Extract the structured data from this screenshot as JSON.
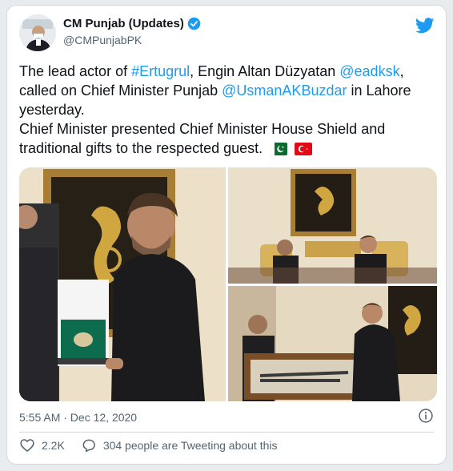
{
  "author": {
    "display_name": "CM Punjab (Updates)",
    "handle": "@CMPunjabPK",
    "verified": true
  },
  "tweet": {
    "text_part1": "The lead actor of ",
    "hashtag": "#Ertugrul",
    "text_part2": ", Engin Altan Düzyatan ",
    "mention1": "@eadksk",
    "text_part3": ", called on Chief Minister Punjab ",
    "mention2": "@UsmanAKBuzdar",
    "text_part4": " in Lahore yesterday.",
    "text_line2": "Chief Minister presented Chief Minister House Shield and traditional gifts to the respected guest. "
  },
  "meta": {
    "timestamp": "5:55 AM · Dec 12, 2020"
  },
  "actions": {
    "likes": "2.2K",
    "tweeting": "304 people are Tweeting about this"
  },
  "colors": {
    "accent": "#1d9bf0",
    "text": "#0f1419",
    "muted": "#536471",
    "border": "#cfd9de"
  },
  "icons": [
    "verified-badge-icon",
    "twitter-bird-icon",
    "info-icon",
    "heart-icon",
    "speech-bubble-icon",
    "pakistan-flag-icon",
    "turkey-flag-icon"
  ]
}
